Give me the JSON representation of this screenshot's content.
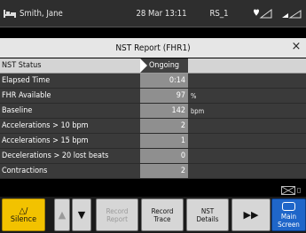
{
  "header": {
    "patient_name": "Smith, Jane",
    "datetime": "28 Mar 13:11",
    "bed_label": "RS_1",
    "icons": [
      "bed-icon",
      "heart-signal-icon",
      "wireless-signal-icon"
    ]
  },
  "report": {
    "title": "NST Report (FHR1)",
    "close_glyph": "×",
    "status_label": "NST Status",
    "status_value": "Ongoing",
    "rows": [
      {
        "label": "Elapsed Time",
        "value": "0:14",
        "unit": ""
      },
      {
        "label": "FHR Available",
        "value": "97",
        "unit": "%"
      },
      {
        "label": "Baseline",
        "value": "142",
        "unit": "bpm"
      },
      {
        "label": "Accelerations > 10 bpm",
        "value": "2",
        "unit": ""
      },
      {
        "label": "Accelerations > 15 bpm",
        "value": "1",
        "unit": ""
      },
      {
        "label": "Decelerations > 20 lost beats",
        "value": "0",
        "unit": ""
      },
      {
        "label": "Contractions",
        "value": "2",
        "unit": ""
      }
    ]
  },
  "toolbar": {
    "silence_glyph": "△/",
    "silence_label": "Silence",
    "up_glyph": "▲",
    "down_glyph": "▼",
    "record_report_line1": "Record",
    "record_report_line2": "Report",
    "record_trace_line1": "Record",
    "record_trace_line2": "Trace",
    "nst_details_line1": "NST",
    "nst_details_line2": "Details",
    "forward_glyph": "▶▶",
    "main_screen_line1": "Main",
    "main_screen_line2": "Screen"
  },
  "colors": {
    "silence": "#f2c200",
    "main_screen": "#1f66c9",
    "value_column": "#8f8f8f",
    "title_bar": "#e6e6e6"
  }
}
